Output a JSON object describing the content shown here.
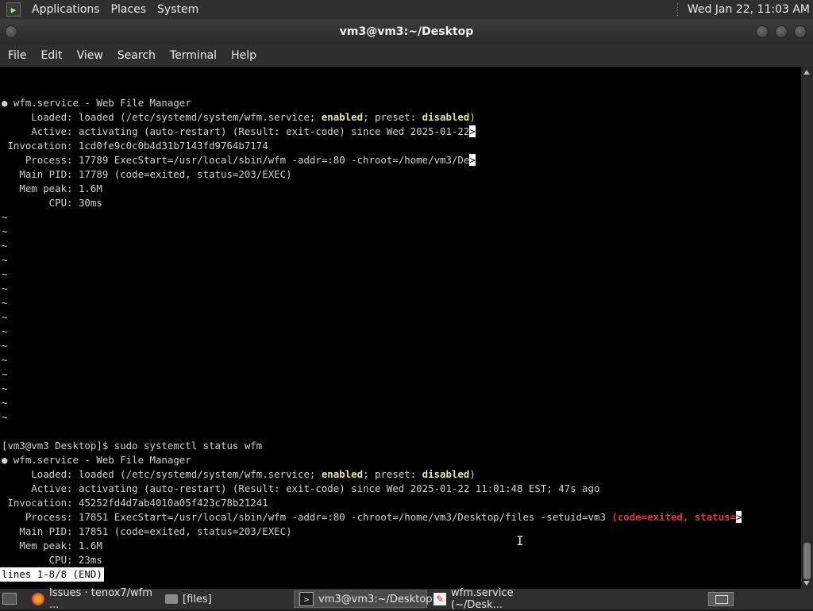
{
  "topbar": {
    "menus": [
      "Applications",
      "Places",
      "System"
    ],
    "clock": "Wed Jan 22, 11:03 AM"
  },
  "window": {
    "title": "vm3@vm3:~/Desktop",
    "menu": [
      "File",
      "Edit",
      "View",
      "Search",
      "Terminal",
      "Help"
    ]
  },
  "terminal": {
    "block1": {
      "l1": "● wfm.service - Web File Manager",
      "l2a": "     Loaded: loaded (/etc/systemd/system/wfm.service; ",
      "l2b": "enabled",
      "l2c": "; preset: ",
      "l2d": "disabled",
      "l2e": ")",
      "l3": "     Active: activating (auto-restart) (Result: exit-code) since Wed 2025-01-22",
      "l4": " Invocation: 1cd0fe9c0c0b4d31b7143fd9764b7174",
      "l5": "    Process: 17789 ExecStart=/usr/local/sbin/wfm -addr=:80 -chroot=/home/vm3/De",
      "l6": "   Main PID: 17789 (code=exited, status=203/EXEC)",
      "l7": "   Mem peak: 1.6M",
      "l8": "        CPU: 30ms"
    },
    "tilde": "~",
    "overflow_marker": ">",
    "block2": {
      "prompt": "[vm3@vm3 Desktop]$ sudo systemctl status wfm",
      "l1": "● wfm.service - Web File Manager",
      "l2a": "     Loaded: loaded (/etc/systemd/system/wfm.service; ",
      "l2b": "enabled",
      "l2c": "; preset: ",
      "l2d": "disabled",
      "l2e": ")",
      "l3": "     Active: activating (auto-restart) (Result: exit-code) since Wed 2025-01-22 11:01:48 EST; 47s ago",
      "l4": " Invocation: 45252fd4d7ab4010a05f423c78b21241",
      "l5": "    Process: 17851 ExecStart=/usr/local/sbin/wfm -addr=:80 -chroot=/home/vm3/Desktop/files -setuid=vm3 ",
      "l5red": "(code=exited, status=",
      "l6": "   Main PID: 17851 (code=exited, status=203/EXEC)",
      "l7": "   Mem peak: 1.6M",
      "l8": "        CPU: 23ms",
      "status": "lines 1-8/8 (END)"
    }
  },
  "taskbar": {
    "items": [
      {
        "label": "Issues · tenox7/wfm ...",
        "icon": "firefox-icon"
      },
      {
        "label": "[files]",
        "icon": "folder-icon"
      },
      {
        "label": "vm3@vm3:~/Desktop",
        "icon": "terminal-icon"
      },
      {
        "label": "wfm.service (~/Desk...",
        "icon": "text-editor-icon"
      }
    ]
  }
}
